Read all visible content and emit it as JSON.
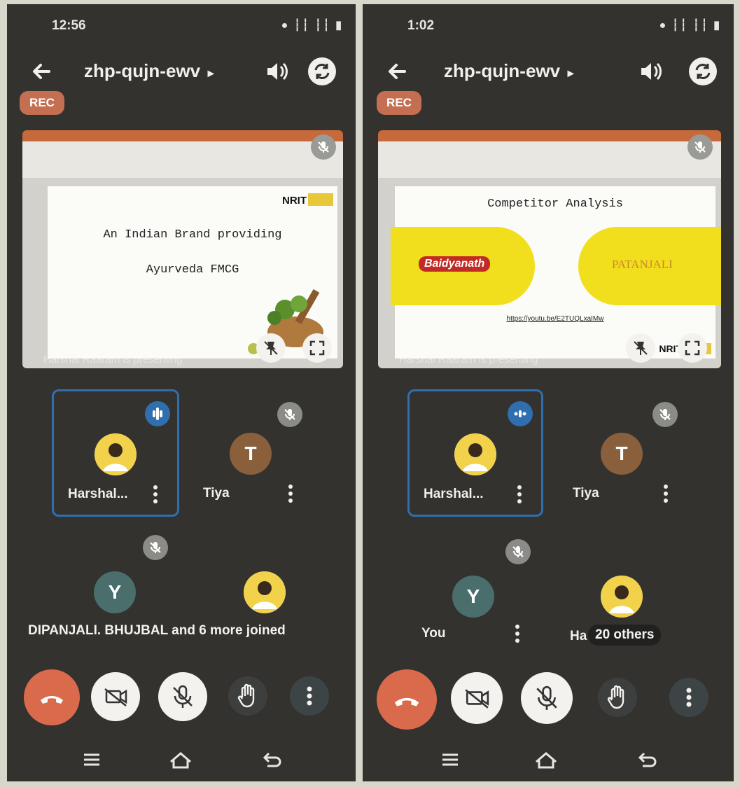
{
  "colors": {
    "rec": "#c56f52",
    "end_call": "#d96a4c",
    "active_speaker": "#2f6fb0",
    "avatar_t": "#8a5f3c",
    "avatar_y": "#4a6e6c"
  },
  "left": {
    "status": {
      "time": "12:56",
      "right_icons": "● ┆┆ ┆┆ ▮"
    },
    "meeting_code": "zhp-qujn-ewv",
    "rec_label": "REC",
    "slide": {
      "line1": "An Indian Brand providing",
      "line2": "Ayurveda FMCG",
      "logo": "NRIT"
    },
    "presenting_text": "Harshal Raaram is presenting",
    "tiles": [
      {
        "name": "Harshal...",
        "avatar": "photo",
        "active": true
      },
      {
        "name": "Tiya",
        "avatar": "T",
        "active": false
      },
      {
        "name": "",
        "avatar": "Y",
        "active": false
      },
      {
        "name": "",
        "avatar": "photo",
        "active": false
      }
    ],
    "toast": "DIPANJALI. BHUJBAL and 6 more joined"
  },
  "right": {
    "status": {
      "time": "1:02",
      "right_icons": "● ┆┆ ┆┆ ▮"
    },
    "meeting_code": "zhp-qujn-ewv",
    "rec_label": "REC",
    "slide": {
      "title": "Competitor Analysis",
      "brand1": "Baidyanath",
      "brand2": "PATANJALI",
      "link": "https://youtu.be/E2TUQLxaIMw",
      "logo": "NRIT"
    },
    "presenting_text": "Harshal Raaram is presenting",
    "tiles": [
      {
        "name": "Harshal...",
        "avatar": "photo",
        "active": true
      },
      {
        "name": "Tiya",
        "avatar": "T",
        "active": false
      },
      {
        "name": "You",
        "avatar": "Y",
        "active": false
      },
      {
        "name": "Ha",
        "avatar": "photo",
        "active": false,
        "overlay": "20 others"
      }
    ]
  }
}
